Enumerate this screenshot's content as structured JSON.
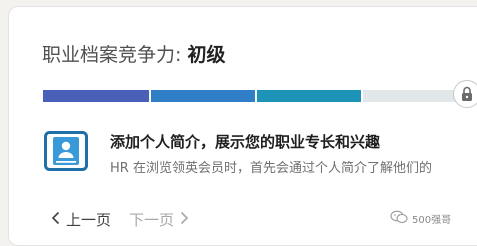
{
  "section": {
    "title_prefix": "职业档案竞争力: ",
    "title_level": "初级"
  },
  "progress": {
    "completed_segments": 3,
    "total_segments": 4,
    "segment_colors": [
      "#4a5fb8",
      "#2f7ec6",
      "#1e93b8",
      "#e2e7e9"
    ]
  },
  "suggestion": {
    "icon": "profile-card-icon",
    "title": "添加个人简介，展示您的职业专长和兴趣",
    "description": "HR 在浏览领英会员时，首先会通过个人简介了解他们的"
  },
  "pager": {
    "prev_label": "上一页",
    "next_label": "下一页"
  },
  "watermark": {
    "text": "500强哥"
  }
}
